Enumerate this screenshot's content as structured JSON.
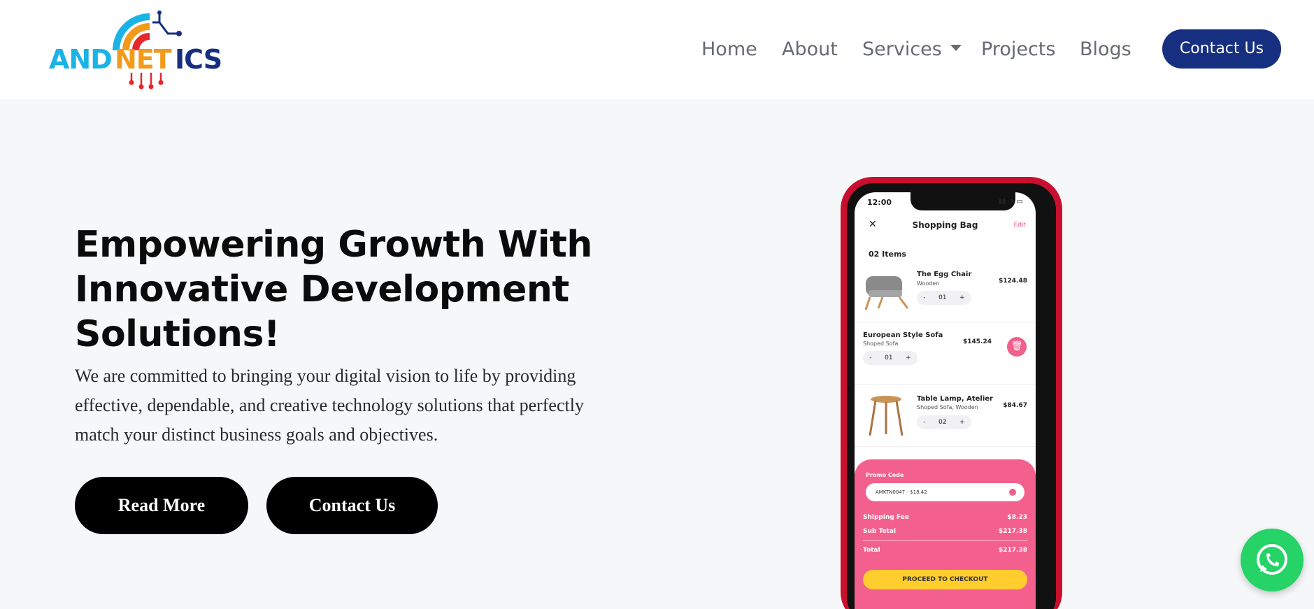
{
  "brand": {
    "logo_text": "ANDNETICS",
    "colors": {
      "navy": "#172f80",
      "cyan": "#1ab3e6",
      "orange": "#f39a1b",
      "red": "#e5262a"
    }
  },
  "nav": {
    "items": [
      "Home",
      "About",
      "Services",
      "Projects",
      "Blogs"
    ],
    "cta": "Contact Us"
  },
  "hero": {
    "title_lines": [
      "Empowering Growth With",
      "Innovative Development",
      "Solutions!"
    ],
    "description_lines": [
      "We are committed to bringing your digital vision to life by providing",
      "effective, dependable, and creative technology solutions that perfectly",
      "match your distinct business goals and objectives."
    ],
    "buttons": {
      "read_more": "Read More",
      "contact": "Contact Us"
    }
  },
  "phone": {
    "time": "12:00",
    "title": "Shopping Bag",
    "edit": "Edit",
    "count": "02 Items",
    "items": [
      {
        "name": "The Egg Chair",
        "sub": "Wooden",
        "price": "$124.48",
        "qty": "01"
      },
      {
        "name": "European Style Sofa",
        "sub": "Shoped Sofa",
        "price": "$145.24",
        "qty": "01"
      },
      {
        "name": "Table Lamp, Atelier",
        "sub": "Shoped Sofa, Wooden",
        "price": "$84.67",
        "qty": "02"
      }
    ],
    "promo_label": "Promo Code",
    "promo_value": "AMKTN0047 - $18.42",
    "shipping_label": "Shipping Fee",
    "shipping_value": "$8.23",
    "subtotal_label": "Sub Total",
    "subtotal_value": "$217.38",
    "total_label": "Total",
    "total_value": "$217.38",
    "checkout": "PROCEED TO CHECKOUT"
  },
  "whatsapp": {
    "icon": "whatsapp-icon"
  }
}
